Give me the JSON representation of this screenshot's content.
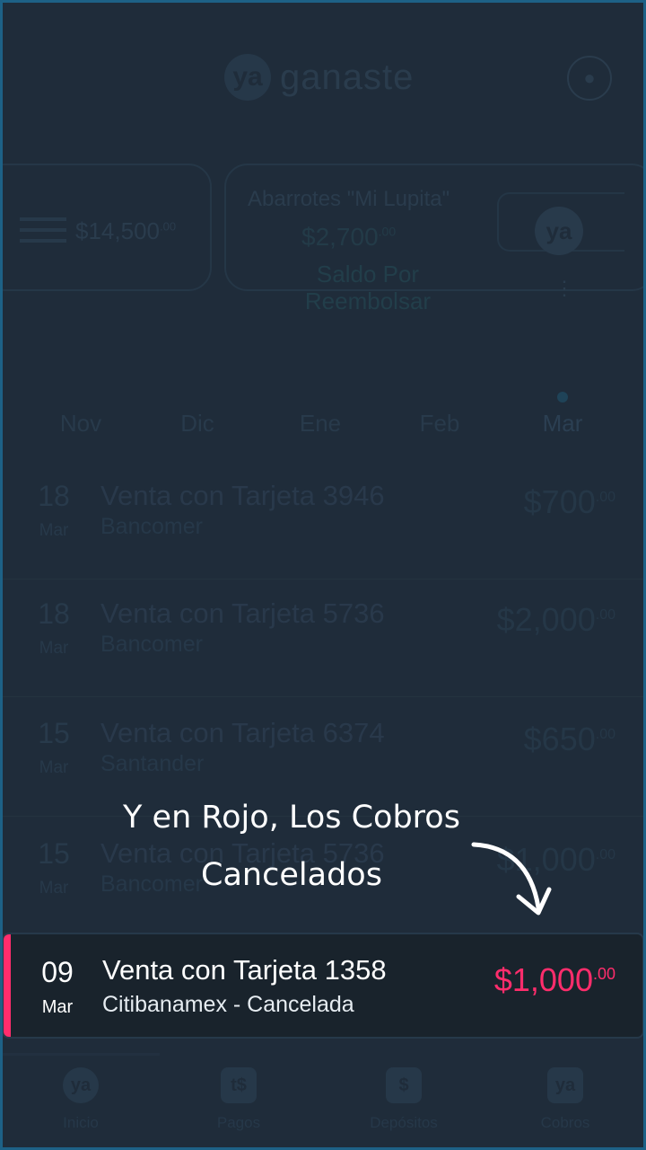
{
  "header": {
    "logo_mark": "ya",
    "logo_text": "ganaste",
    "profile_icon": "user-icon"
  },
  "card_left": {
    "amount": "$14,500",
    "cents": ".00"
  },
  "card_main": {
    "name": "Abarrotes \"Mi Lupita\"",
    "balance": "$2,700",
    "balance_cents": ".00",
    "label_line1": "Saldo Por",
    "label_line2": "Reembolsar",
    "badge": "ya"
  },
  "months": [
    "Nov",
    "Dic",
    "Ene",
    "Feb",
    "Mar"
  ],
  "transactions": [
    {
      "day": "18",
      "month": "Mar",
      "title": "Venta con Tarjeta 3946",
      "bank": "Bancomer",
      "amount": "$700",
      "cents": ".00"
    },
    {
      "day": "18",
      "month": "Mar",
      "title": "Venta con Tarjeta 5736",
      "bank": "Bancomer",
      "amount": "$2,000",
      "cents": ".00"
    },
    {
      "day": "15",
      "month": "Mar",
      "title": "Venta con Tarjeta 6374",
      "bank": "Santander",
      "amount": "$650",
      "cents": ".00"
    },
    {
      "day": "15",
      "month": "Mar",
      "title": "Venta con Tarjeta 5736",
      "bank": "Bancomer",
      "amount": "$1,000",
      "cents": ".00"
    }
  ],
  "callout": {
    "line1": "Y en Rojo, Los Cobros",
    "line2": "Cancelados"
  },
  "highlighted": {
    "day": "09",
    "month": "Mar",
    "title": "Venta con Tarjeta 1358",
    "sub": "Citibanamex - Cancelada",
    "amount": "$1,000",
    "cents": ".00",
    "accent": "#ff2d6c"
  },
  "nav": [
    {
      "label": "Inicio",
      "icon": "ya"
    },
    {
      "label": "Pagos",
      "icon": "t$"
    },
    {
      "label": "Depósitos",
      "icon": "$"
    },
    {
      "label": "Cobros",
      "icon": "ya"
    }
  ]
}
